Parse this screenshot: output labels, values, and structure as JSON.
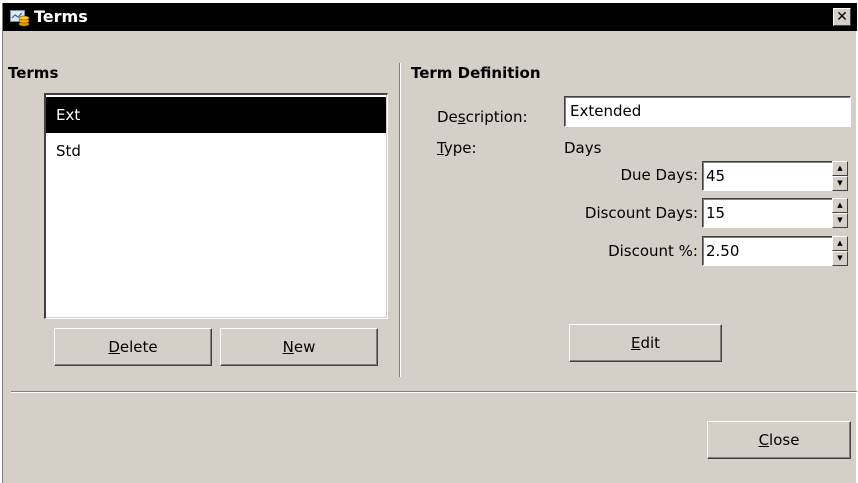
{
  "window": {
    "title": "Terms",
    "close_glyph": "✕"
  },
  "terms_panel": {
    "title": "Terms",
    "items": [
      {
        "label": "Ext",
        "selected": true
      },
      {
        "label": "Std",
        "selected": false
      }
    ],
    "delete_label": "Delete",
    "new_label": "New"
  },
  "definition": {
    "title": "Term Definition",
    "description_label": "Description:",
    "description_value": "Extended",
    "type_label": "Type:",
    "type_value": "Days",
    "due_days_label": "Due Days:",
    "due_days_value": "45",
    "discount_days_label": "Discount Days:",
    "discount_days_value": "15",
    "discount_pct_label": "Discount %:",
    "discount_pct_value": "2.50",
    "edit_label": "Edit"
  },
  "footer": {
    "close_label": "Close"
  },
  "colors": {
    "titlebar": "#000000",
    "dialog_bg": "#d4d0c8",
    "selection": "#000000"
  },
  "icons": {
    "app": "terms-app-icon",
    "spin_up": "▲",
    "spin_down": "▼"
  }
}
